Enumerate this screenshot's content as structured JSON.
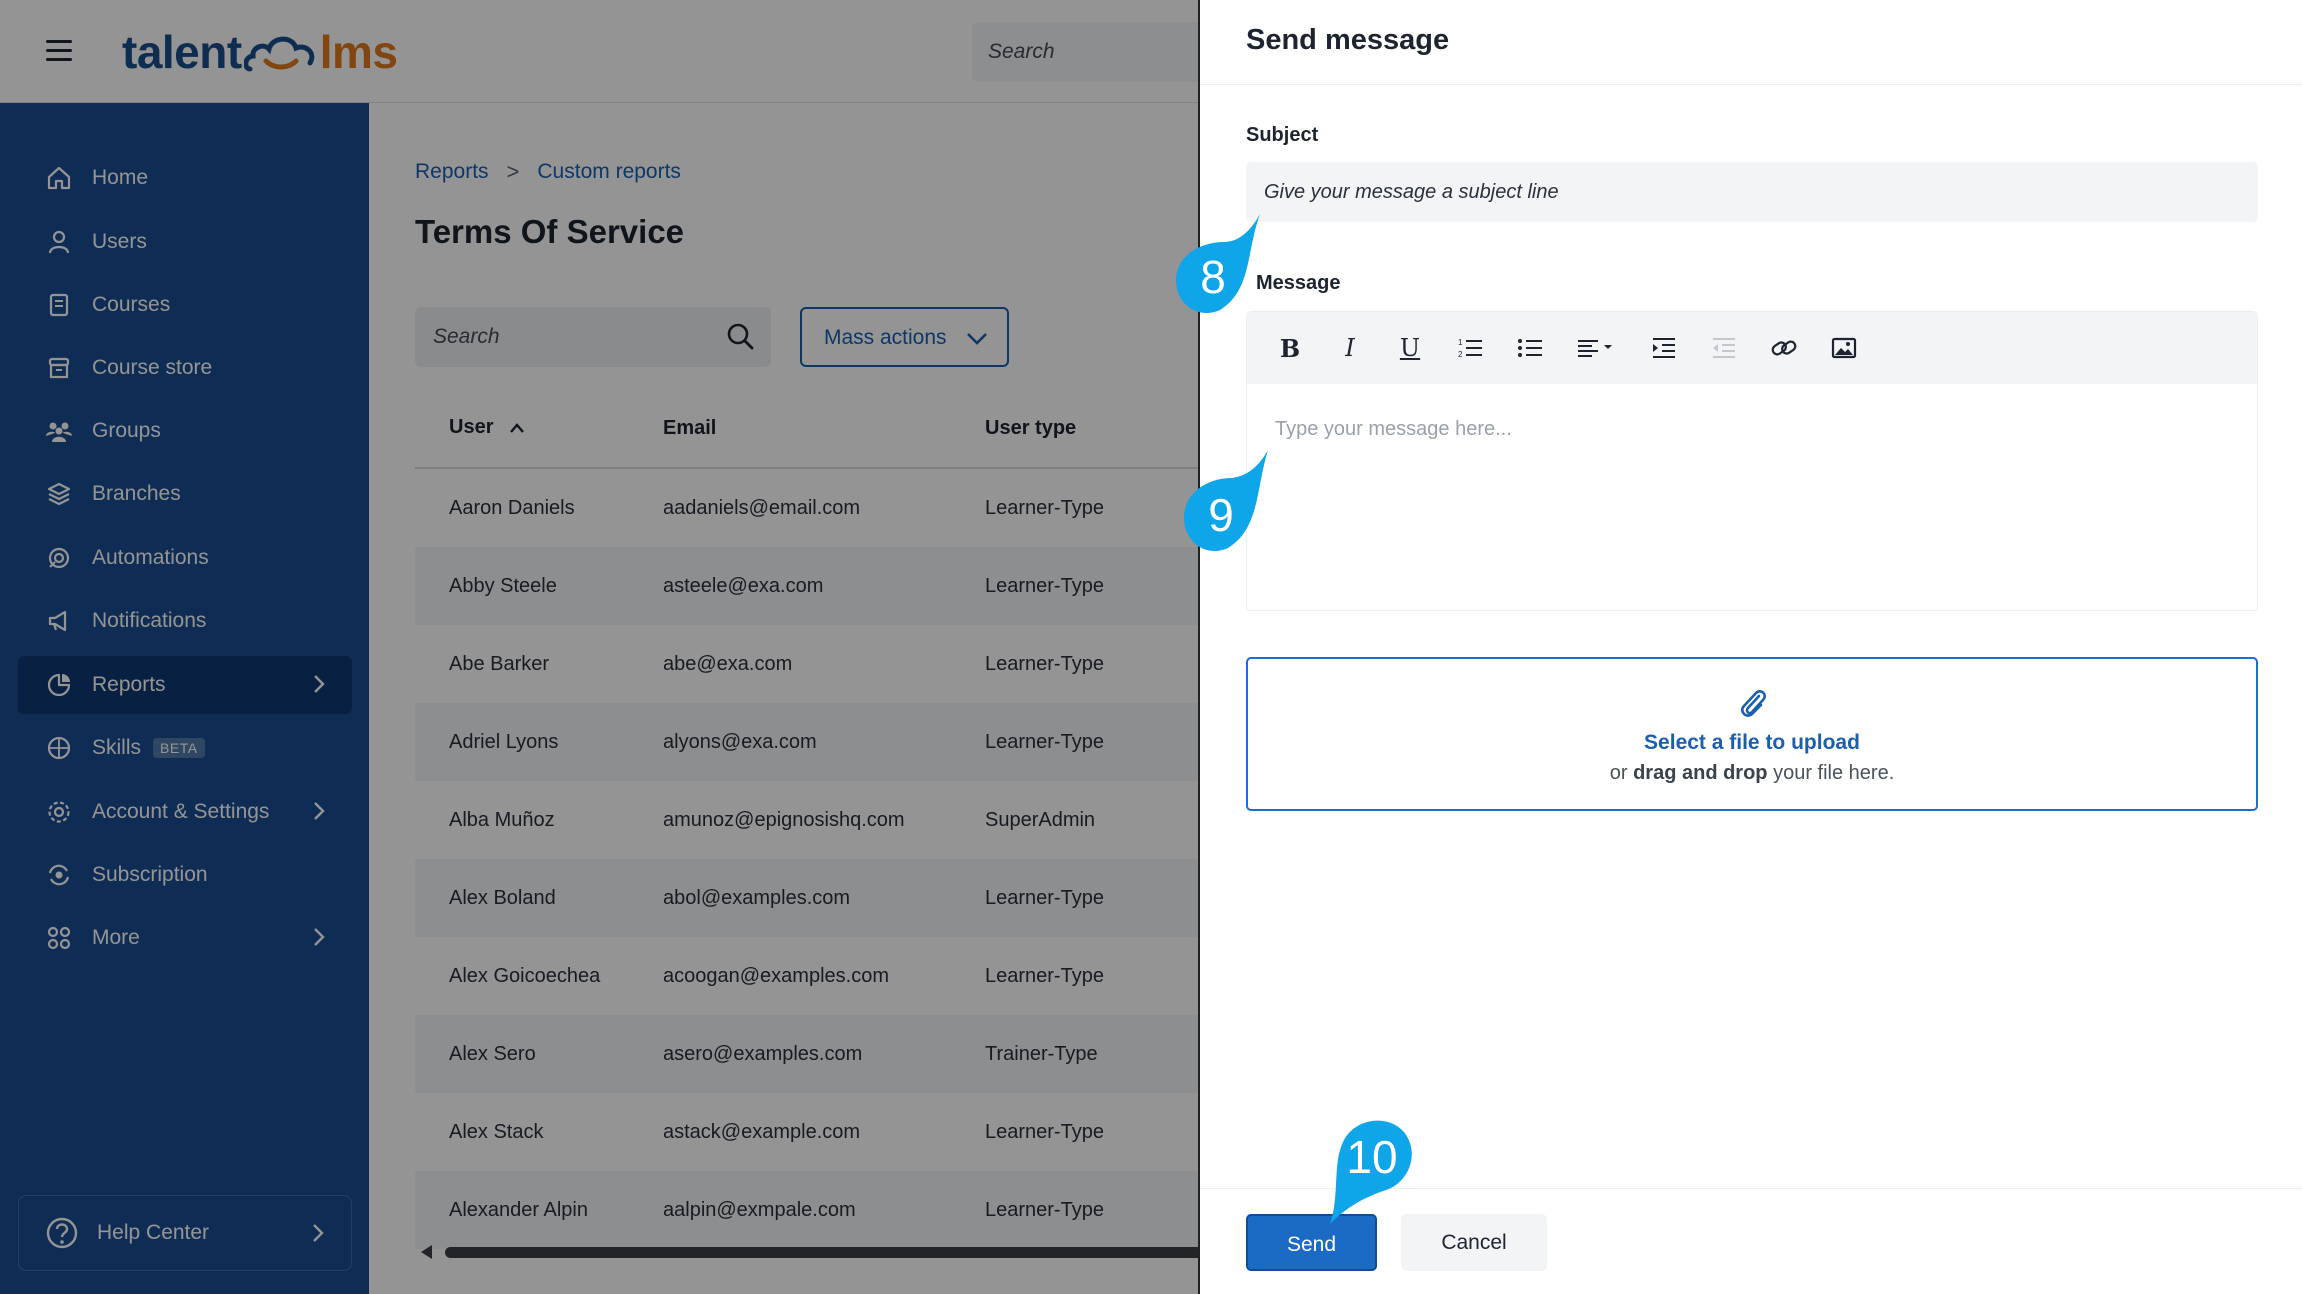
{
  "app": {
    "logo_left": "talent",
    "logo_right": "lms",
    "top_search_placeholder": "Search"
  },
  "sidebar": {
    "items": [
      {
        "label": "Home",
        "icon": "home-icon"
      },
      {
        "label": "Users",
        "icon": "user-icon"
      },
      {
        "label": "Courses",
        "icon": "book-icon"
      },
      {
        "label": "Course store",
        "icon": "store-icon"
      },
      {
        "label": "Groups",
        "icon": "groups-icon"
      },
      {
        "label": "Branches",
        "icon": "layers-icon"
      },
      {
        "label": "Automations",
        "icon": "automation-icon"
      },
      {
        "label": "Notifications",
        "icon": "megaphone-icon"
      },
      {
        "label": "Reports",
        "icon": "pie-chart-icon",
        "active": true
      },
      {
        "label": "Skills",
        "icon": "skills-icon",
        "badge": "BETA"
      },
      {
        "label": "Account & Settings",
        "icon": "gear-icon"
      },
      {
        "label": "Subscription",
        "icon": "subscription-icon"
      },
      {
        "label": "More",
        "icon": "grid-icon"
      }
    ],
    "help_label": "Help Center"
  },
  "main": {
    "breadcrumb": [
      "Reports",
      "Custom reports"
    ],
    "title": "Terms Of Service",
    "search_placeholder": "Search",
    "mass_actions_label": "Mass actions",
    "table": {
      "columns": [
        "User",
        "Email",
        "User type"
      ],
      "rows": [
        [
          "Aaron Daniels",
          "aadaniels@email.com",
          "Learner-Type"
        ],
        [
          "Abby Steele",
          "asteele@exa.com",
          "Learner-Type"
        ],
        [
          "Abe Barker",
          "abe@exa.com",
          "Learner-Type"
        ],
        [
          "Adriel Lyons",
          "alyons@exa.com",
          "Learner-Type"
        ],
        [
          "Alba Muñoz",
          "amunoz@epignosishq.com",
          "SuperAdmin"
        ],
        [
          "Alex Boland",
          "abol@examples.com",
          "Learner-Type"
        ],
        [
          "Alex Goicoechea",
          "acoogan@examples.com",
          "Learner-Type"
        ],
        [
          "Alex Sero",
          "asero@examples.com",
          "Trainer-Type"
        ],
        [
          "Alex Stack",
          "astack@example.com",
          "Learner-Type"
        ],
        [
          "Alexander Alpin",
          "aalpin@exmpale.com",
          "Learner-Type"
        ]
      ]
    }
  },
  "panel": {
    "title": "Send message",
    "subject_label": "Subject",
    "subject_placeholder": "Give your message a subject line",
    "message_label": "Message",
    "message_placeholder": "Type your message here...",
    "upload_link": "Select a file to upload",
    "upload_or": "or ",
    "upload_drag": "drag and drop",
    "upload_rest": " your file here.",
    "send_label": "Send",
    "cancel_label": "Cancel"
  },
  "callouts": [
    "8",
    "9",
    "10"
  ],
  "colors": {
    "brand_blue": "#1a4e92",
    "accent_blue": "#1b6bc4",
    "callout": "#0ea5e9",
    "logo_orange": "#e07a1e"
  }
}
